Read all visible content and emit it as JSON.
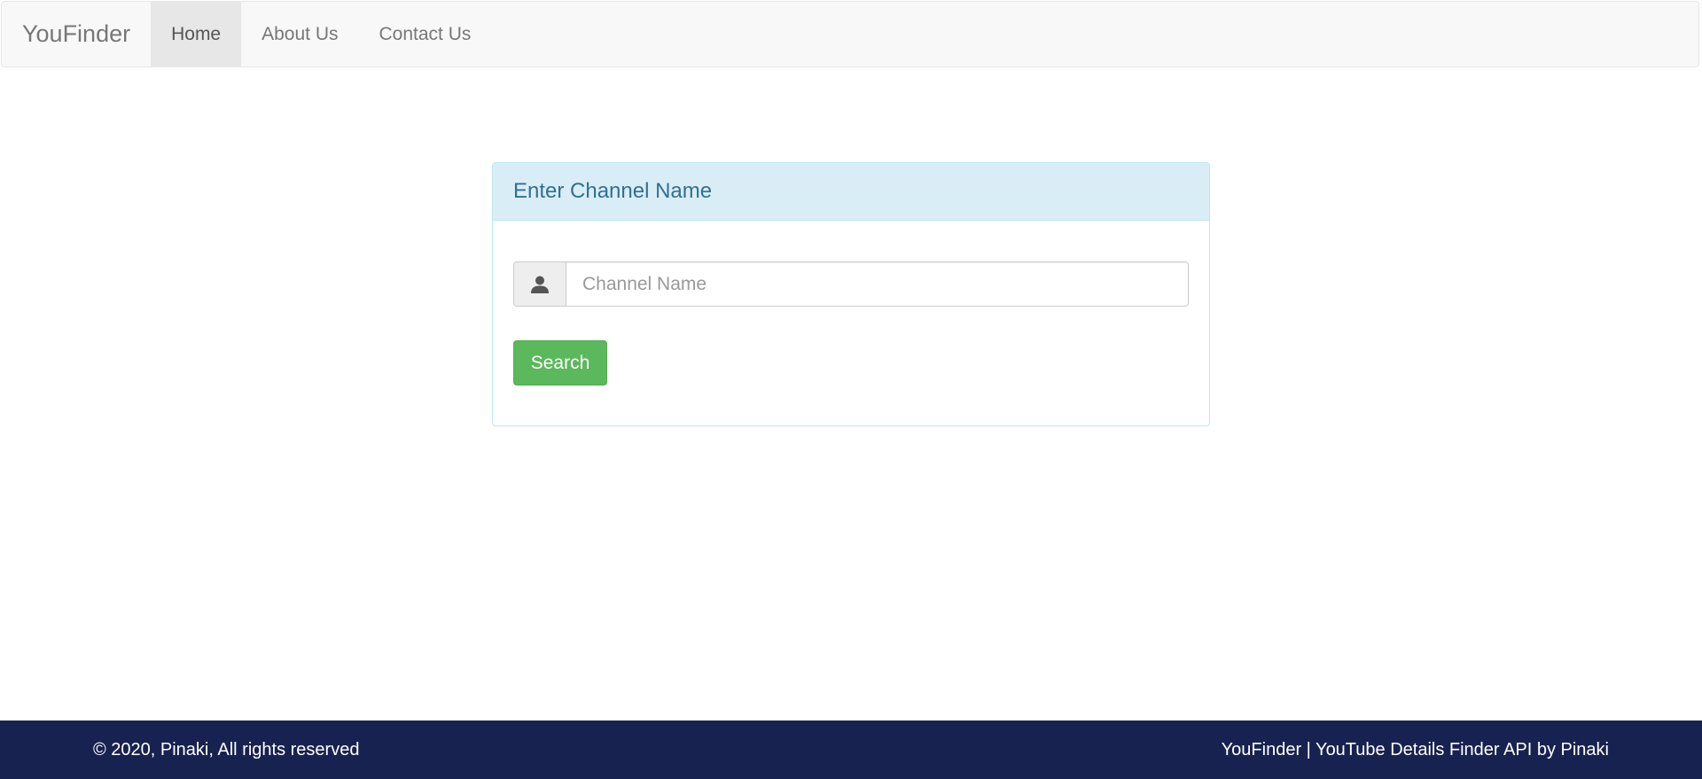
{
  "navbar": {
    "brand": "YouFinder",
    "items": [
      {
        "label": "Home",
        "active": true
      },
      {
        "label": "About Us",
        "active": false
      },
      {
        "label": "Contact Us",
        "active": false
      }
    ]
  },
  "panel": {
    "heading": "Enter Channel Name",
    "input": {
      "value": "",
      "placeholder": "Channel Name",
      "icon": "user-icon"
    },
    "search_label": "Search"
  },
  "footer": {
    "left_text": "© 2020, Pinaki, All rights reserved",
    "right_text": "YouFinder | YouTube Details Finder API by Pinaki"
  },
  "colors": {
    "navbar_bg": "#f8f8f8",
    "panel_heading_bg": "#d9edf7",
    "panel_heading_text": "#31708f",
    "search_button": "#5cb85c",
    "footer_bg": "#172250"
  }
}
